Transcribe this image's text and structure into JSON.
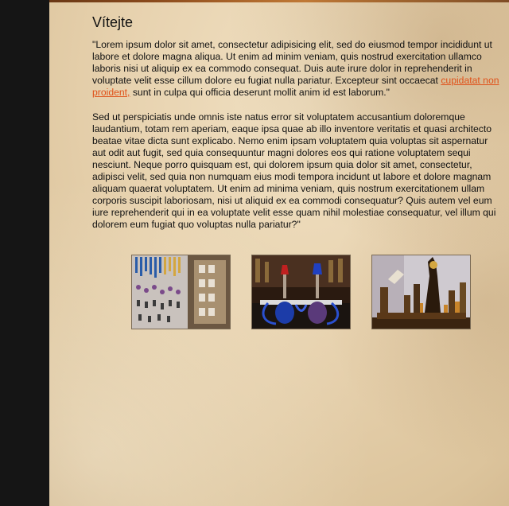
{
  "page": {
    "heading": "Vítejte",
    "paragraph1_before_link": "\"Lorem ipsum dolor sit amet, consectetur adipisicing elit, sed do eiusmod tempor incididunt ut labore et dolore magna aliqua. Ut enim ad minim veniam, quis nostrud exercitation ullamco laboris nisi ut aliquip ex ea commodo consequat. Duis aute irure dolor in reprehenderit in voluptate velit esse cillum dolore eu fugiat nulla pariatur. Excepteur sint occaecat ",
    "paragraph1_link": "cupidatat non proident,",
    "paragraph1_after_link": " sunt in culpa qui officia deserunt mollit anim id est laborum.\"",
    "paragraph2": "Sed ut perspiciatis unde omnis iste natus error sit voluptatem accusantium doloremque laudantium, totam rem aperiam, eaque ipsa quae ab illo inventore veritatis et quasi architecto beatae vitae dicta sunt explicabo. Nemo enim ipsam voluptatem quia voluptas sit aspernatur aut odit aut fugit, sed quia consequuntur magni dolores eos qui ratione voluptatem sequi nesciunt. Neque porro quisquam est, qui dolorem ipsum quia dolor sit amet, consectetur, adipisci velit, sed quia non numquam eius modi tempora incidunt ut labore et dolore magnam aliquam quaerat voluptatem. Ut enim ad minima veniam, quis nostrum exercitationem ullam corporis suscipit laboriosam, nisi ut aliquid ex ea commodi consequatur? Quis autem vel eum iure reprehenderit qui in ea voluptate velit esse quam nihil molestiae consequatur, vel illum qui dolorem eum fugiat quo voluptas nulla pariatur?\""
  },
  "colors": {
    "sidebar": "#151515",
    "link": "#e0521a",
    "text": "#111111"
  },
  "gallery": [
    {
      "subject": "jewelry-display-photo"
    },
    {
      "subject": "hookah-pipes-photo"
    },
    {
      "subject": "egyptian-figurines-photo"
    }
  ]
}
